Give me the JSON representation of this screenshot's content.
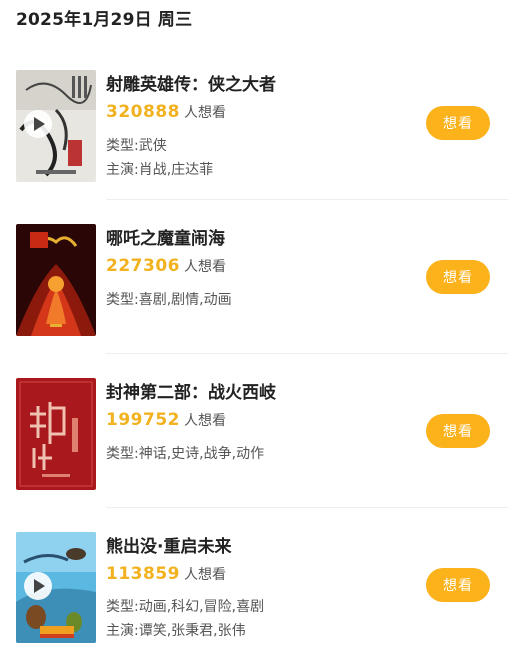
{
  "date_header": "2025年1月29日 周三",
  "want_button_label": "想看",
  "want_suffix": "人想看",
  "accent_color": "#fbb21b",
  "count_color": "#f2b21f",
  "movies": [
    {
      "title": "射雕英雄传：侠之大者",
      "want_count": "320888",
      "genre": "类型:武侠",
      "cast": "主演:肖战,庄达菲",
      "has_play": true
    },
    {
      "title": "哪吒之魔童闹海",
      "want_count": "227306",
      "genre": "类型:喜剧,剧情,动画",
      "cast": "",
      "has_play": false
    },
    {
      "title": "封神第二部：战火西岐",
      "want_count": "199752",
      "genre": "类型:神话,史诗,战争,动作",
      "cast": "",
      "has_play": false
    },
    {
      "title": "熊出没·重启未来",
      "want_count": "113859",
      "genre": "类型:动画,科幻,冒险,喜剧",
      "cast": "主演:谭笑,张秉君,张伟",
      "has_play": true
    }
  ]
}
